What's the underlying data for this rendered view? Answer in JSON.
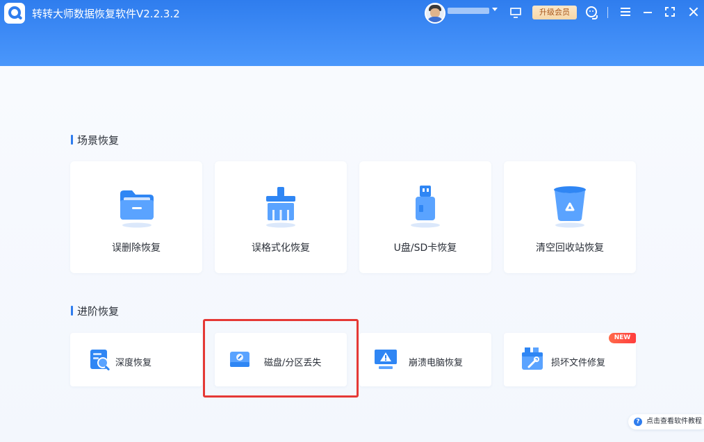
{
  "titlebar": {
    "app_title": "转转大师数据恢复软件V2.2.3.2",
    "upgrade_label": "升级会员"
  },
  "scene_section": {
    "title": "场景恢复",
    "items": [
      {
        "label": "误删除恢复",
        "icon": "folder-icon"
      },
      {
        "label": "误格式化恢复",
        "icon": "broom-icon"
      },
      {
        "label": "U盘/SD卡恢复",
        "icon": "usb-drive-icon"
      },
      {
        "label": "清空回收站恢复",
        "icon": "recycle-bin-icon"
      }
    ]
  },
  "advanced_section": {
    "title": "进阶恢复",
    "items": [
      {
        "label": "深度恢复",
        "icon": "deep-scan-icon"
      },
      {
        "label": "磁盘/分区丢失",
        "icon": "disk-icon"
      },
      {
        "label": "崩溃电脑恢复",
        "icon": "crashed-computer-icon"
      },
      {
        "label": "损坏文件修复",
        "icon": "file-repair-icon",
        "badge": "NEW"
      }
    ]
  },
  "help": {
    "label": "点击查看软件教程",
    "icon_glyph": "?"
  },
  "colors": {
    "primary": "#2f7dee",
    "highlight": "#e53935",
    "badge": "#ff4a3d"
  }
}
